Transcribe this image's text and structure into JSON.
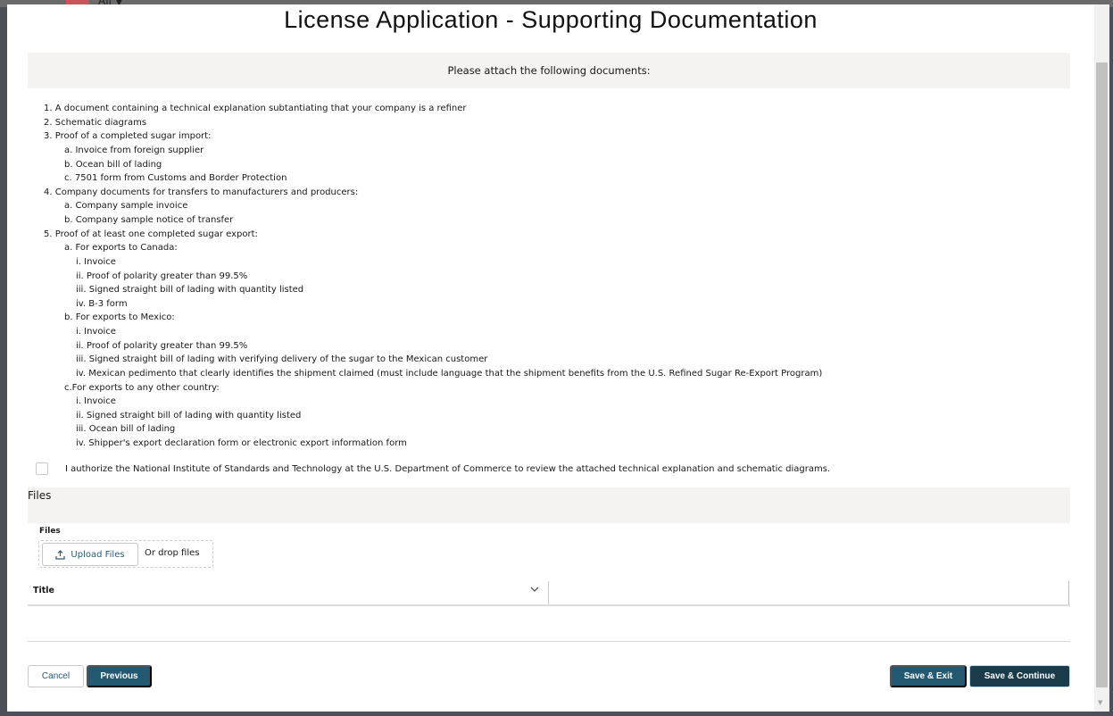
{
  "background": {
    "filter_label": "All ▼"
  },
  "title": "License Application - Supporting Documentation",
  "instructions": "Please attach the following documents:",
  "list": [
    {
      "level": 1,
      "text": "1. A document containing a technical explanation subtantiating that your company is a refiner"
    },
    {
      "level": 1,
      "text": "2. Schematic diagrams"
    },
    {
      "level": 1,
      "text": "3. Proof of a completed sugar import:"
    },
    {
      "level": 2,
      "text": "a. Invoice from foreign supplier"
    },
    {
      "level": 2,
      "text": "b. Ocean bill of lading"
    },
    {
      "level": 2,
      "text": "c. 7501 form from Customs and Border Protection"
    },
    {
      "level": 1,
      "text": "4. Company documents for transfers to manufacturers and producers:"
    },
    {
      "level": 2,
      "text": "a. Company sample invoice"
    },
    {
      "level": 2,
      "text": "b. Company sample notice of transfer"
    },
    {
      "level": 1,
      "text": "5. Proof of at least one completed sugar export:"
    },
    {
      "level": 2,
      "text": "a. For exports to Canada:"
    },
    {
      "level": 3,
      "text": "i. Invoice"
    },
    {
      "level": 3,
      "text": "ii. Proof of polarity greater than 99.5%"
    },
    {
      "level": 3,
      "text": "iii. Signed straight bill of lading with quantity listed"
    },
    {
      "level": 3,
      "text": "iv. B-3 form"
    },
    {
      "level": 2,
      "text": "b. For exports to Mexico:"
    },
    {
      "level": 3,
      "text": "i. Invoice"
    },
    {
      "level": 3,
      "text": "ii. Proof of polarity greater than 99.5%"
    },
    {
      "level": 3,
      "text": "iii. Signed straight bill of lading with verifying delivery of the sugar to the Mexican customer"
    },
    {
      "level": 3,
      "text": "iv. Mexican pedimento that clearly identifies the shipment claimed (must include language that the shipment benefits from the U.S. Refined Sugar Re-Export Program)"
    },
    {
      "level": 2,
      "text": "c.For exports to any other country:"
    },
    {
      "level": 3,
      "text": "i. Invoice"
    },
    {
      "level": 3,
      "text": "ii. Signed straight bill of lading with quantity listed"
    },
    {
      "level": 3,
      "text": "iii. Ocean bill of lading"
    },
    {
      "level": 3,
      "text": "iv. Shipper's export declaration form or electronic export information form"
    }
  ],
  "authorization": {
    "checked": false,
    "label": "I authorize the National Institute of Standards and Technology at the U.S. Department of Commerce to review the attached technical explanation and schematic diagrams."
  },
  "files_section": {
    "heading": "Files",
    "field_label": "Files",
    "upload_label": "Upload Files",
    "drop_label": "Or drop files",
    "table_header_title": "Title"
  },
  "buttons": {
    "cancel": "Cancel",
    "previous": "Previous",
    "save_exit": "Save & Exit",
    "save_continue": "Save & Continue"
  }
}
